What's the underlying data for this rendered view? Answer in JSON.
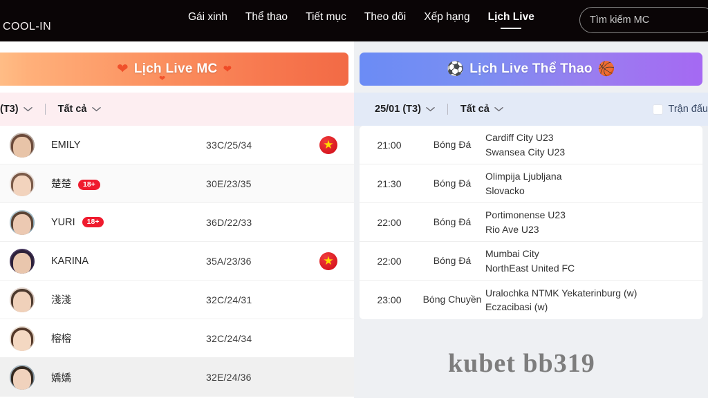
{
  "header": {
    "logo": "COOL-IN",
    "nav": [
      {
        "label": "Gái xinh",
        "active": false
      },
      {
        "label": "Thể thao",
        "active": false
      },
      {
        "label": "Tiết mục",
        "active": false
      },
      {
        "label": "Theo dõi",
        "active": false
      },
      {
        "label": "Xếp hạng",
        "active": false
      },
      {
        "label": "Lịch Live",
        "active": true
      }
    ],
    "search": {
      "placeholder": "Tìm kiếm MC",
      "value": "",
      "icon": "search-icon"
    }
  },
  "left_panel": {
    "banner_title": "Lịch Live MC",
    "banner_icon": "heart-icon",
    "filters": {
      "date": "(T3)",
      "category": "Tất cả",
      "chevron_icon": "chevron-down-icon"
    },
    "rows": [
      {
        "name": "EMILY",
        "badge": "",
        "stats": "33C/25/34",
        "flag": "★"
      },
      {
        "name": "楚楚",
        "badge": "18+",
        "stats": "30E/23/35",
        "flag": ""
      },
      {
        "name": "YURI",
        "badge": "18+",
        "stats": "36D/22/33",
        "flag": ""
      },
      {
        "name": "KARINA",
        "badge": "",
        "stats": "35A/23/36",
        "flag": "★"
      },
      {
        "name": "淺淺",
        "badge": "",
        "stats": "32C/24/31",
        "flag": ""
      },
      {
        "name": "榕榕",
        "badge": "",
        "stats": "32C/24/34",
        "flag": ""
      },
      {
        "name": "嬌嬌",
        "badge": "",
        "stats": "32E/24/36",
        "flag": ""
      }
    ]
  },
  "right_panel": {
    "banner_title": "Lịch Live Thể Thao",
    "banner_icon_left": "soccer-ball-icon",
    "banner_icon_right": "basketball-icon",
    "filters": {
      "date": "25/01 (T3)",
      "category": "Tất cả",
      "checkbox_label": "Trận đấu",
      "checkbox_checked": false,
      "chevron_icon": "chevron-down-icon"
    },
    "rows": [
      {
        "time": "21:00",
        "kind": "Bóng Đá",
        "home": "Cardiff City U23",
        "away": "Swansea City U23"
      },
      {
        "time": "21:30",
        "kind": "Bóng Đá",
        "home": "Olimpija Ljubljana",
        "away": "Slovacko"
      },
      {
        "time": "22:00",
        "kind": "Bóng Đá",
        "home": "Portimonense U23",
        "away": "Rio Ave U23"
      },
      {
        "time": "22:00",
        "kind": "Bóng Đá",
        "home": "Mumbai City",
        "away": "NorthEast United FC"
      },
      {
        "time": "23:00",
        "kind": "Bóng Chuyền",
        "home": "Uralochka NTMK Yekaterinburg (w)",
        "away": "Eczacibasi (w)"
      }
    ]
  },
  "watermark": "kubet bb319",
  "colors": {
    "header_bg": "#0a0506",
    "left_banner_start": "#ffd9a0",
    "left_banner_end": "#f26a45",
    "right_banner_start": "#6b8cf5",
    "right_banner_end": "#a569f3",
    "left_filter_bg": "#fdeef1",
    "right_filter_bg": "#e3eaf7",
    "badge_red": "#ef1b2e",
    "flag_red": "#cf0a16",
    "flag_star": "#ffdd00"
  }
}
